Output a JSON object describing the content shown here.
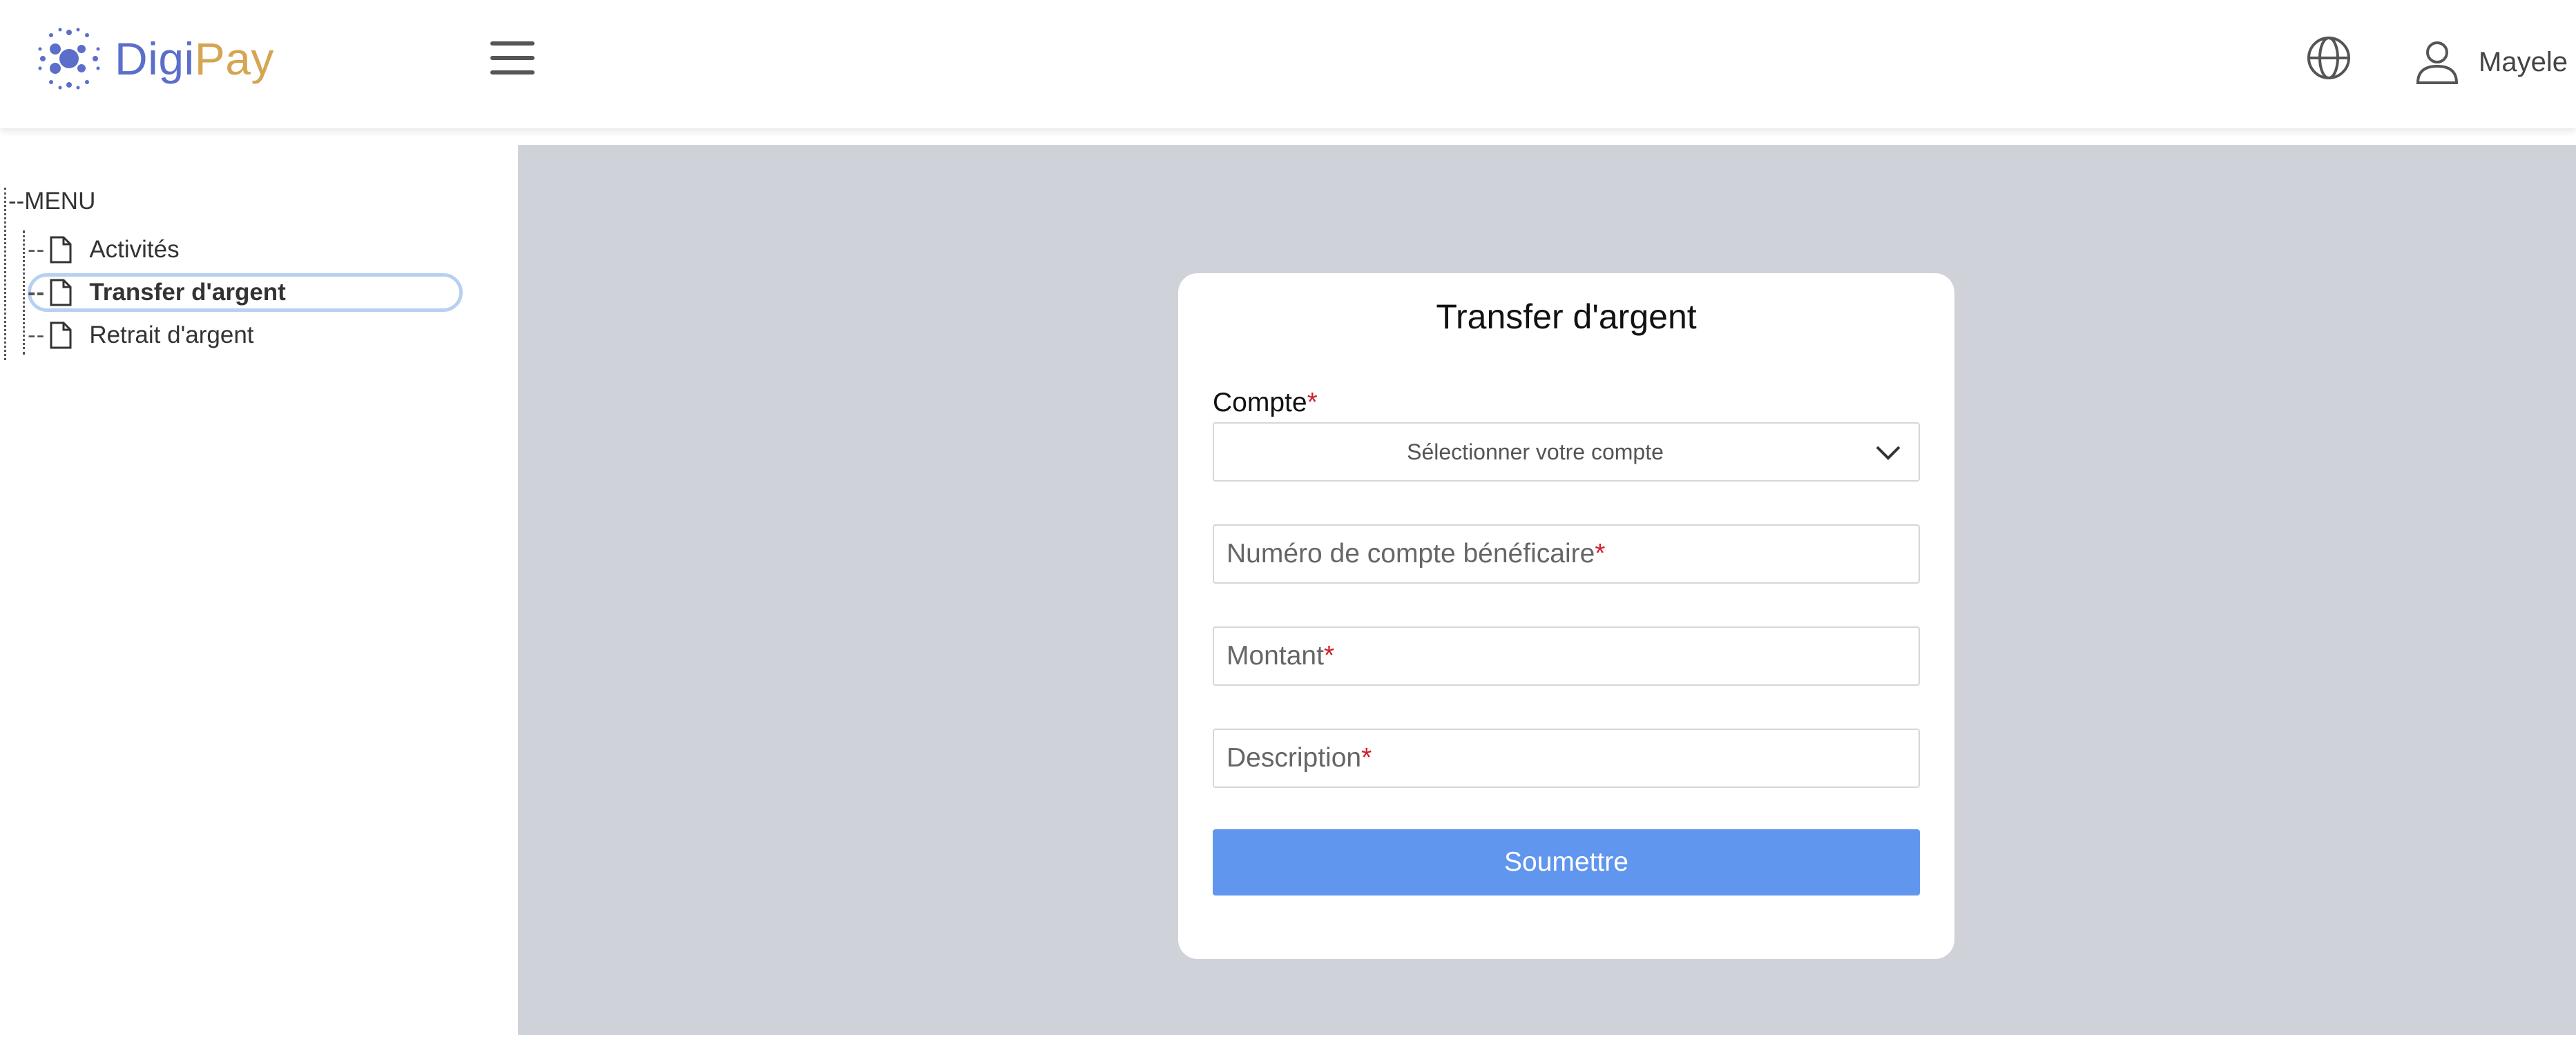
{
  "brand": {
    "name_part1": "Digi",
    "name_part2": "Pay",
    "color_primary": "#5b6ec9",
    "color_secondary": "#d5a552"
  },
  "header": {
    "menu_icon": "hamburger-icon",
    "language_icon": "globe-icon",
    "user_icon": "user-icon",
    "user_name": "Mayele"
  },
  "sidebar": {
    "root_label": "--MENU",
    "items": [
      {
        "label": "Activités",
        "icon": "file-icon",
        "active": false
      },
      {
        "label": "Transfer d'argent",
        "icon": "file-icon",
        "active": true
      },
      {
        "label": "Retrait d'argent",
        "icon": "file-icon",
        "active": false
      }
    ]
  },
  "form": {
    "title": "Transfer d'argent",
    "compte_label": "Compte",
    "compte_placeholder": "Sélectionner votre compte",
    "beneficiary_placeholder": "Numéro de compte bénéficaire",
    "amount_placeholder": "Montant",
    "description_placeholder": "Description",
    "required_mark": "*",
    "submit_label": "Soumettre"
  },
  "colors": {
    "main_background": "#d0d2d9",
    "submit_button": "#6196ee",
    "required": "#d0202a",
    "active_ring": "#b7d0f2"
  }
}
